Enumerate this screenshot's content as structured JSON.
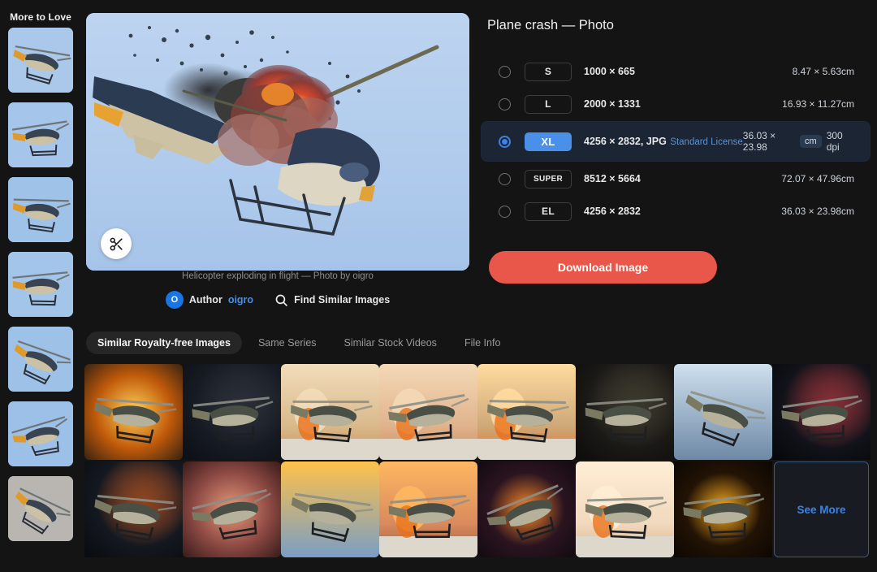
{
  "sidebar": {
    "title": "More to Love",
    "thumbs": [
      {
        "name": "helicopter-blue-sky-1"
      },
      {
        "name": "helicopter-blue-sky-2"
      },
      {
        "name": "helicopter-blue-sky-3"
      },
      {
        "name": "helicopter-blue-sky-4"
      },
      {
        "name": "helicopter-white-underside"
      },
      {
        "name": "helicopter-orange-nose"
      },
      {
        "name": "helicopter-dusk-clouds"
      }
    ]
  },
  "hero": {
    "crop_icon": "scissors-icon",
    "caption": "Helicopter exploding in flight — Photo by oigro"
  },
  "meta": {
    "avatar_initial": "O",
    "author_label": "Author",
    "author_name": "oigro",
    "search_icon": "search-icon",
    "find_similar_label": "Find Similar Images"
  },
  "right": {
    "title": "Plane crash — Photo",
    "download_label": "Download Image",
    "sizes": [
      {
        "code": "S",
        "pixels": "1000 × 665",
        "license": "",
        "physical": "8.47 × 5.63cm",
        "unit": "",
        "dpi": "",
        "selected": false
      },
      {
        "code": "L",
        "pixels": "2000 × 1331",
        "license": "",
        "physical": "16.93 × 11.27cm",
        "unit": "",
        "dpi": "",
        "selected": false
      },
      {
        "code": "XL",
        "pixels": "4256 × 2832, JPG",
        "license": "Standard License",
        "physical": "36.03 × 23.98",
        "unit": "cm",
        "dpi": "300 dpi",
        "selected": true
      },
      {
        "code": "SUPER",
        "pixels": "8512 × 5664",
        "license": "",
        "physical": "72.07 × 47.96cm",
        "unit": "",
        "dpi": "",
        "selected": false
      },
      {
        "code": "EL",
        "pixels": "4256 × 2832",
        "license": "",
        "physical": "36.03 × 23.98cm",
        "unit": "",
        "dpi": "",
        "selected": false
      }
    ]
  },
  "tabs": [
    {
      "label": "Similar Royalty-free Images",
      "active": true
    },
    {
      "label": "Same Series",
      "active": false
    },
    {
      "label": "Similar Stock Videos",
      "active": false
    },
    {
      "label": "File Info",
      "active": false
    }
  ],
  "grid": {
    "see_more_label": "See More",
    "items": [
      {
        "name": "thumb-fireball-helicopter"
      },
      {
        "name": "thumb-blackhawk-night"
      },
      {
        "name": "thumb-beach-explosion-1"
      },
      {
        "name": "thumb-beach-explosion-2"
      },
      {
        "name": "thumb-mushroom-cloud"
      },
      {
        "name": "thumb-blackhawk-dark"
      },
      {
        "name": "thumb-helicopter-blue-smoke"
      },
      {
        "name": "thumb-helicopter-pink-flare"
      },
      {
        "name": "thumb-helicopter-explosion-dark"
      },
      {
        "name": "thumb-cobra-red-smoke"
      },
      {
        "name": "thumb-helicopter-blue-fire"
      },
      {
        "name": "thumb-helicopter-orange-sea"
      },
      {
        "name": "thumb-helicopter-sparks"
      },
      {
        "name": "thumb-helicopter-pale-dawn"
      },
      {
        "name": "thumb-helicopter-inferno"
      }
    ]
  },
  "colors": {
    "accent_red": "#e8574a",
    "accent_blue": "#3b82e8",
    "background": "#141414",
    "selected_row": "#1b2533"
  }
}
